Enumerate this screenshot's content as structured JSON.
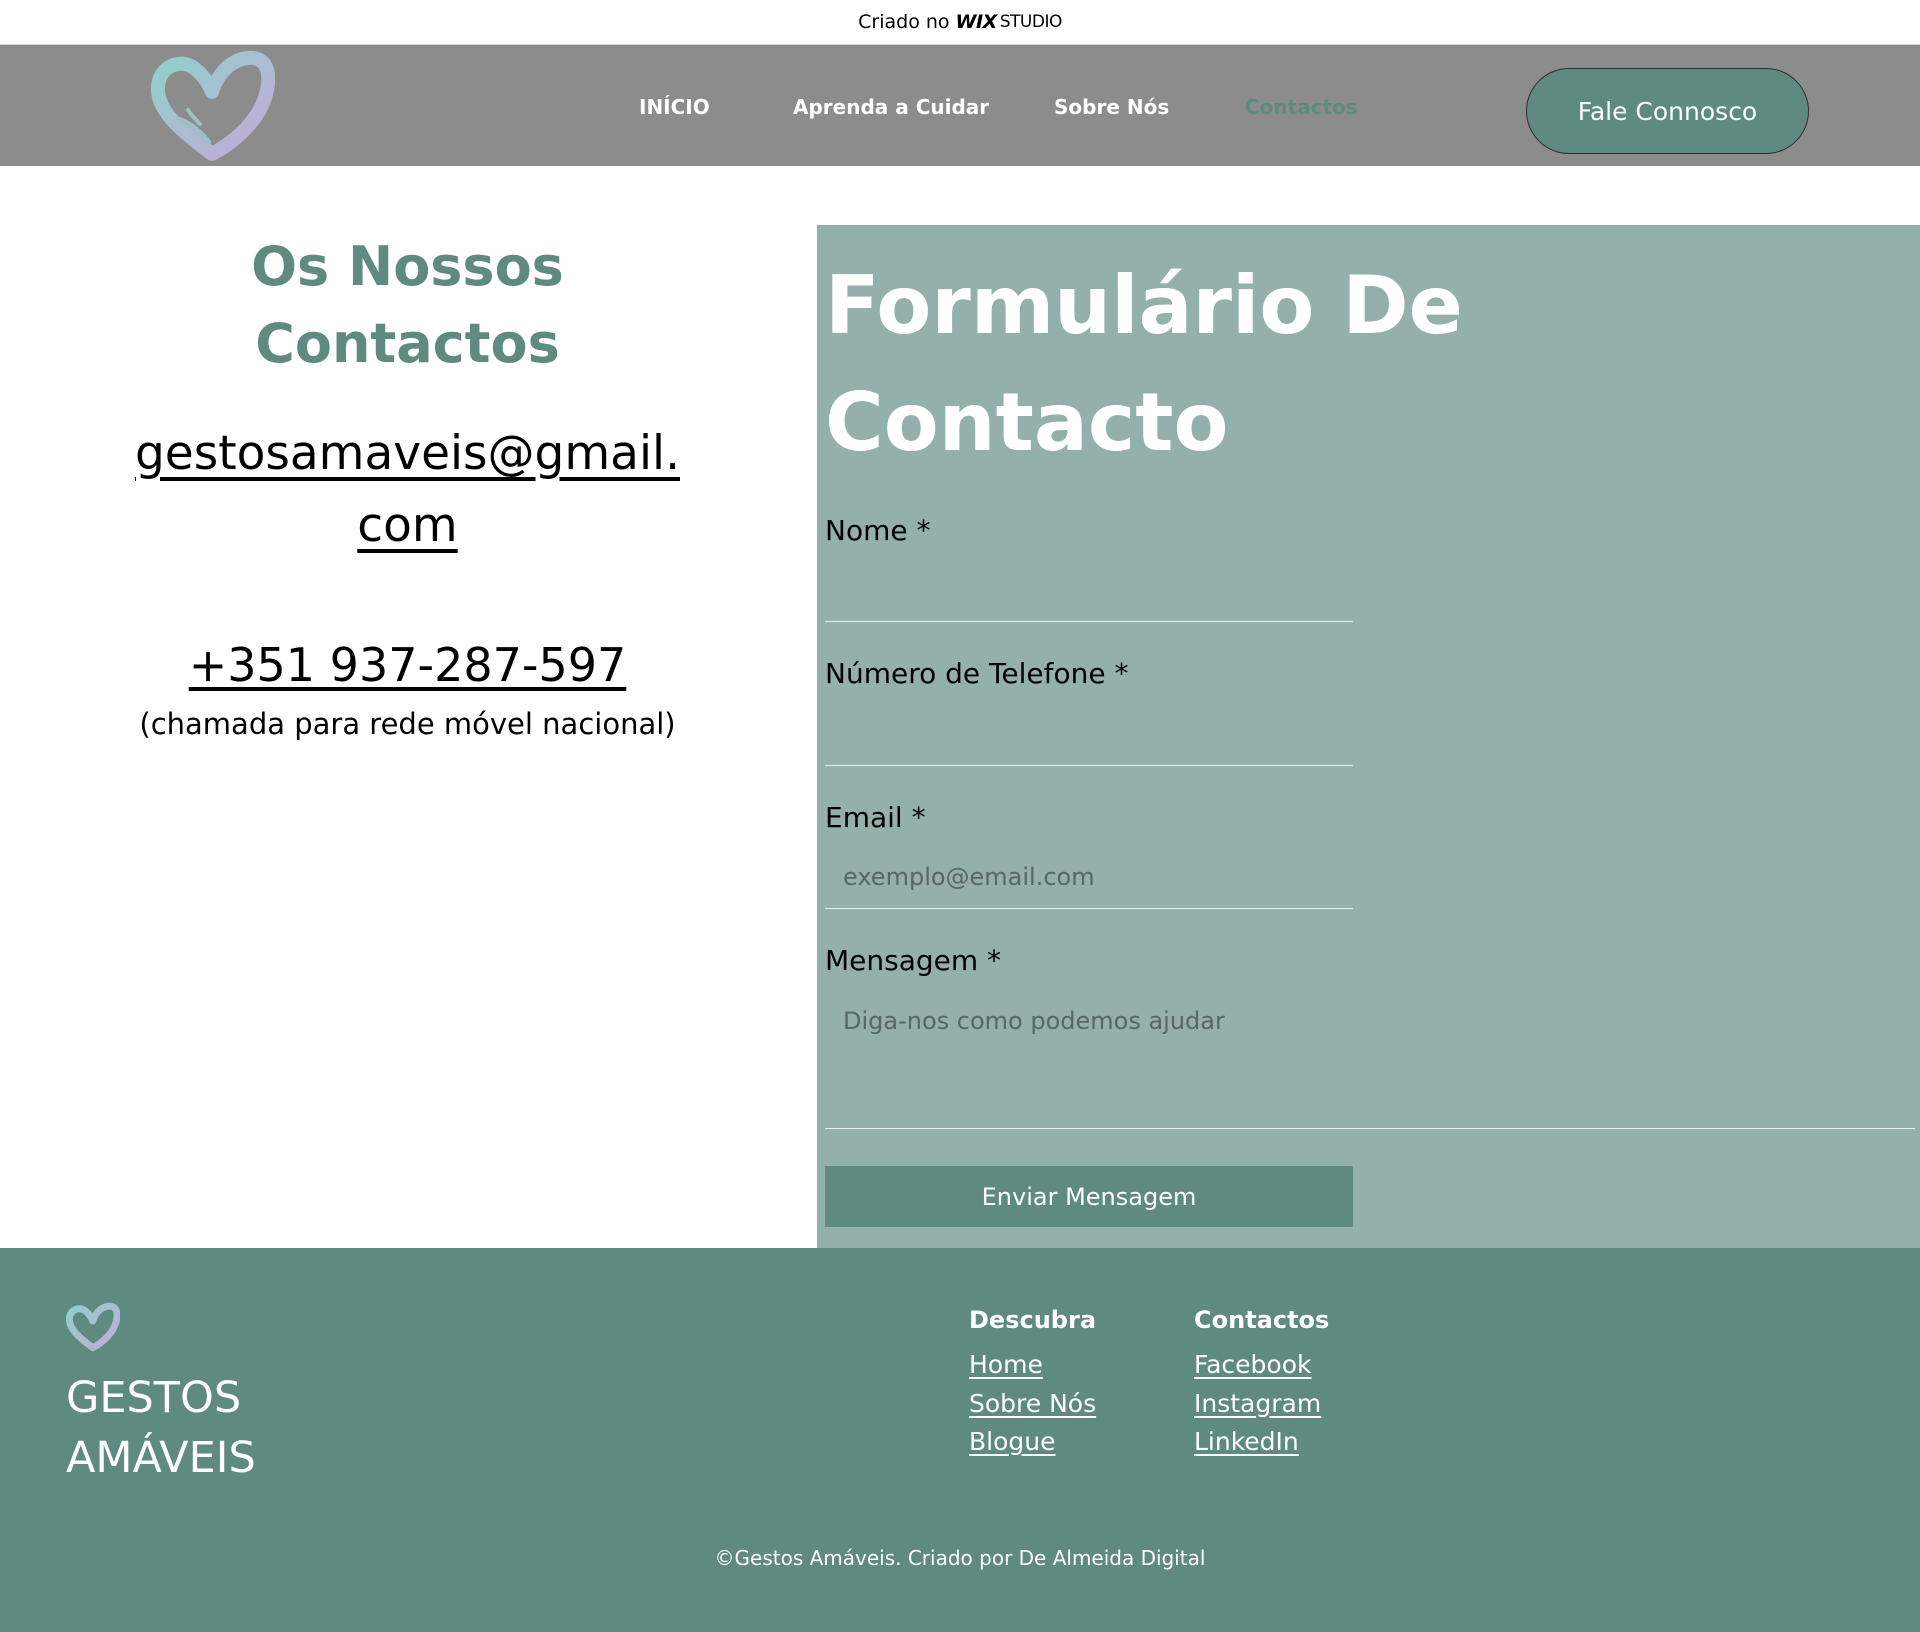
{
  "wix_banner": {
    "prefix": "Criado no",
    "brand": "WIX",
    "suffix": "STUDIO"
  },
  "header": {
    "nav": [
      {
        "label": "INÍCIO",
        "active": false
      },
      {
        "label": "Aprenda a Cuidar",
        "active": false
      },
      {
        "label": "Sobre Nós",
        "active": false
      },
      {
        "label": "Contactos",
        "active": true
      }
    ],
    "cta_label": "Fale Connosco"
  },
  "contacts": {
    "title_line1": "Os Nossos",
    "title_line2": "Contactos",
    "email": "gestosamaveis@gmail.com",
    "phone": "+351 937-287-597",
    "phone_note": "(chamada para rede móvel nacional)"
  },
  "form": {
    "title_line1": "Formulário De",
    "title_line2": "Contacto",
    "fields": {
      "name_label": "Nome *",
      "phone_label": "Número de Telefone *",
      "email_label": "Email *",
      "email_placeholder": "exemplo@email.com",
      "message_label": "Mensagem *",
      "message_placeholder": "Diga-nos como podemos ajudar"
    },
    "submit_label": "Enviar Mensagem"
  },
  "footer": {
    "brand_line1": "GESTOS",
    "brand_line2": "AMÁVEIS",
    "discover": {
      "title": "Descubra",
      "links": [
        "Home",
        "Sobre Nós",
        "Blogue"
      ]
    },
    "contacts": {
      "title": "Contactos",
      "links": [
        "Facebook",
        "Instagram",
        "LinkedIn"
      ]
    },
    "copyright": "©Gestos Amáveis. Criado por De Almeida Digital"
  },
  "colors": {
    "brand_green": "#5f8a80",
    "panel_green": "#94b0aa",
    "header_gray": "#8c8c8c",
    "logo_gradient": [
      "#8fd1c9",
      "#c7a8dc"
    ]
  },
  "icons": {
    "logo": "heart-hands-logo-icon"
  }
}
